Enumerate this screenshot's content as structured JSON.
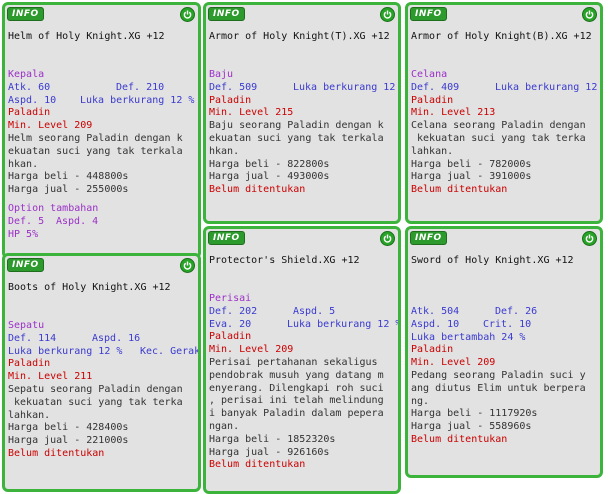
{
  "badge": "INFO",
  "cards": [
    {
      "title": "Helm of Holy Knight.XG +12",
      "category": "Kepala",
      "atk": "Atk. 60",
      "def": "Def. 210",
      "aspd": "Aspd. 10",
      "luka": "Luka berkurang 12 %",
      "job": "Paladin",
      "level": "Min. Level 209",
      "desc": [
        "Helm seorang Paladin dengan k",
        "ekuatan suci yang tak terkala",
        "hkan."
      ],
      "buy": "Harga beli - 448800s",
      "sell": "Harga jual - 255000s",
      "option_title": "Option tambahan",
      "opt_def": "Def. 5",
      "opt_aspd": "Aspd. 4",
      "opt_hp": "HP 5%"
    },
    {
      "title": "Armor of Holy Knight(T).XG +12",
      "category": "Baju",
      "def": "Def. 509",
      "luka": "Luka berkurang 12",
      "job": "Paladin",
      "level": "Min. Level 215",
      "desc": [
        "Baju seorang Paladin dengan k",
        "ekuatan suci yang tak terkala",
        "hkan."
      ],
      "buy": "Harga beli - 822800s",
      "sell": "Harga jual - 493000s",
      "status": "Belum ditentukan"
    },
    {
      "title": "Armor of Holy Knight(B).XG +12",
      "category": "Celana",
      "def": "Def. 409",
      "luka": "Luka berkurang 12",
      "job": "Paladin",
      "level": "Min. Level 213",
      "desc": [
        "Celana seorang Paladin dengan",
        " kekuatan suci yang tak terka",
        "lahkan."
      ],
      "buy": "Harga beli - 782000s",
      "sell": "Harga jual - 391000s",
      "status": "Belum ditentukan"
    },
    {
      "title": "Boots of Holy Knight.XG +12",
      "category": "Sepatu",
      "def": "Def. 114",
      "aspd": "Aspd. 16",
      "luka": "Luka berkurang 12 %",
      "kec": "Kec. Gerak",
      "job": "Paladin",
      "level": "Min. Level 211",
      "desc": [
        "Sepatu seorang Paladin dengan",
        " kekuatan suci yang tak terka",
        "lahkan."
      ],
      "buy": "Harga beli - 428400s",
      "sell": "Harga jual - 221000s",
      "status": "Belum ditentukan"
    },
    {
      "title": "Protector's Shield.XG +12",
      "category": "Perisai",
      "def": "Def. 202",
      "aspd": "Aspd. 5",
      "eva": "Eva. 20",
      "luka": "Luka berkurang 12 %",
      "job": "Paladin",
      "level": "Min. Level 209",
      "desc": [
        "Perisai pertahanan sekaligus",
        "pendobrak musuh yang datang m",
        "enyerang. Dilengkapi roh suci",
        ", perisai ini telah melindung",
        "i banyak Paladin dalam pepera",
        "ngan."
      ],
      "buy": "Harga beli - 1852320s",
      "sell": "Harga jual - 926160s",
      "status": "Belum ditentukan"
    },
    {
      "title": "Sword of Holy Knight.XG +12",
      "atk": "Atk. 504",
      "def": "Def. 26",
      "aspd": "Aspd. 10",
      "crit": "Crit. 10",
      "luka": "Luka bertambah 24 %",
      "job": "Paladin",
      "level": "Min. Level 209",
      "desc": [
        "Pedang seorang Paladin suci y",
        "ang diutus Elim untuk berpera",
        "ng."
      ],
      "buy": "Harga beli - 1117920s",
      "sell": "Harga jual - 558960s",
      "status": "Belum ditentukan"
    }
  ],
  "colors": {
    "border": "#3cb43c",
    "panel": "#e2e2e2",
    "category": "#9b30c8",
    "stat": "#3a3ad0",
    "requirement": "#cc0000",
    "text": "#333333"
  }
}
